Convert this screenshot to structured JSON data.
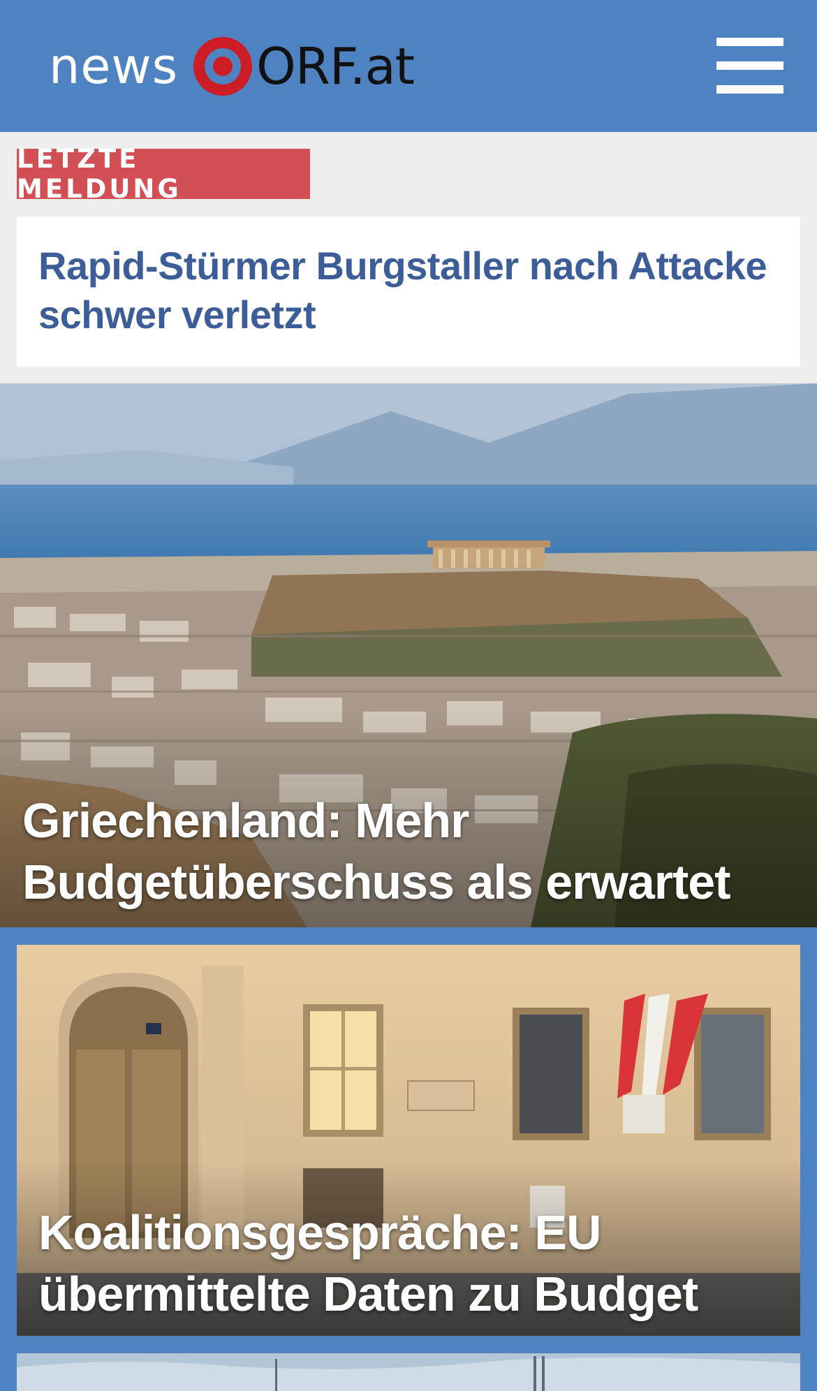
{
  "header": {
    "logo_news": "news",
    "logo_orf": "ORF.at",
    "menu_icon": "hamburger-menu-icon"
  },
  "breaking": {
    "badge": "LETZTE MELDUNG",
    "title": "Rapid-Stürmer Burgstaller nach Attacke schwer verletzt"
  },
  "stories": [
    {
      "title": "Griechenland: Mehr Budgetüberschuss als erwartet"
    },
    {
      "title": "Koalitionsgespräche: EU übermittelte Daten zu Budget"
    }
  ],
  "colors": {
    "header_bg": "#4f82c1",
    "logo_red": "#cc1c25",
    "badge_red": "#d24f56",
    "headline_blue": "#3c5d98",
    "page_bg": "#eeeeee"
  }
}
